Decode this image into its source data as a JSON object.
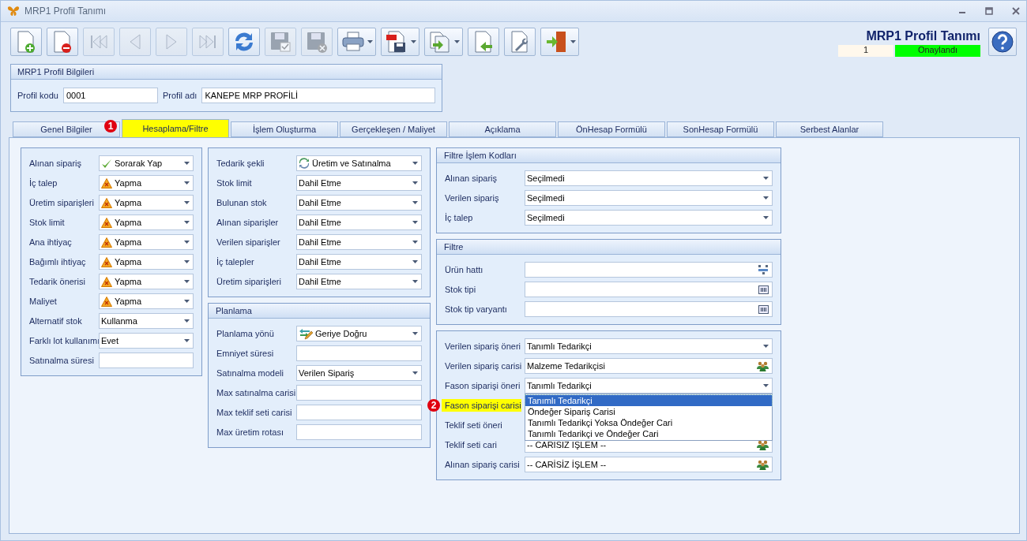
{
  "window": {
    "title": "MRP1 Profil Tanımı"
  },
  "toolbar": [
    {
      "kind": "new",
      "disabled": false,
      "menu": false
    },
    {
      "kind": "delete",
      "disabled": false,
      "menu": false
    },
    {
      "kind": "first",
      "disabled": true,
      "menu": false
    },
    {
      "kind": "prev",
      "disabled": true,
      "menu": false
    },
    {
      "kind": "next",
      "disabled": true,
      "menu": false
    },
    {
      "kind": "last",
      "disabled": true,
      "menu": false
    },
    {
      "kind": "refresh",
      "disabled": false,
      "menu": false
    },
    {
      "kind": "save",
      "disabled": true,
      "menu": false
    },
    {
      "kind": "discard",
      "disabled": true,
      "menu": false
    },
    {
      "kind": "print",
      "disabled": false,
      "menu": true
    },
    {
      "kind": "pdf",
      "disabled": false,
      "menu": true
    },
    {
      "kind": "export",
      "disabled": false,
      "menu": true
    },
    {
      "kind": "import",
      "disabled": false,
      "menu": false
    },
    {
      "kind": "settings",
      "disabled": false,
      "menu": false
    },
    {
      "kind": "exit",
      "disabled": false,
      "menu": true
    }
  ],
  "header": {
    "title": "MRP1 Profil Tanımı",
    "number": "1",
    "status": "Onaylandı"
  },
  "profile": {
    "title": "MRP1 Profil Bilgileri",
    "fields": [
      {
        "label": "Profil kodu",
        "value": "0001"
      },
      {
        "label": "Profil adı",
        "value": "KANEPE MRP PROFİLİ"
      }
    ]
  },
  "tabs": [
    {
      "label": "Genel Bilgiler",
      "selected": false,
      "highlighted": false
    },
    {
      "label": "Hesaplama/Filtre",
      "selected": true,
      "highlighted": true,
      "marker": "1"
    },
    {
      "label": "İşlem Oluşturma",
      "selected": false,
      "highlighted": false
    },
    {
      "label": "Gerçekleşen / Maliyet",
      "selected": false,
      "highlighted": false
    },
    {
      "label": "Açıklama",
      "selected": false,
      "highlighted": false
    },
    {
      "label": "ÖnHesap Formülü",
      "selected": false,
      "highlighted": false
    },
    {
      "label": "SonHesap Formülü",
      "selected": false,
      "highlighted": false
    },
    {
      "label": "Serbest Alanlar",
      "selected": false,
      "highlighted": false
    }
  ],
  "columns": [
    [
      {
        "rows": [
          {
            "label": "Alınan sipariş",
            "kind": "okcombo",
            "value": "Sorarak Yap"
          },
          {
            "label": "İç talep",
            "kind": "warncombo",
            "value": "Yapma"
          },
          {
            "label": "Üretim siparişleri",
            "kind": "warncombo",
            "value": "Yapma"
          },
          {
            "label": "Stok limit",
            "kind": "warncombo",
            "value": "Yapma"
          },
          {
            "label": "Ana ihtiyaç",
            "kind": "warncombo",
            "value": "Yapma"
          },
          {
            "label": "Bağımlı ihtiyaç",
            "kind": "warncombo",
            "value": "Yapma"
          },
          {
            "label": "Tedarik önerisi",
            "kind": "warncombo",
            "value": "Yapma"
          },
          {
            "label": "Maliyet",
            "kind": "warncombo",
            "value": "Yapma"
          },
          {
            "label": "Alternatif stok",
            "kind": "combo",
            "value": "Kullanma"
          },
          {
            "label": "Farklı lot kullanımı",
            "kind": "combo",
            "value": "Evet"
          },
          {
            "label": "Satınalma süresi",
            "kind": "text"
          }
        ]
      }
    ],
    [
      {
        "rows": [
          {
            "label": "Tedarik şekli",
            "kind": "cyclecombo",
            "value": "Üretim ve Satınalma"
          },
          {
            "label": "Stok limit",
            "kind": "combo",
            "value": "Dahil Etme"
          },
          {
            "label": "Bulunan stok",
            "kind": "combo",
            "value": "Dahil Etme"
          },
          {
            "label": "Alınan siparişler",
            "kind": "combo",
            "value": "Dahil Etme"
          },
          {
            "label": "Verilen siparişler",
            "kind": "combo",
            "value": "Dahil Etme"
          },
          {
            "label": "İç talepler",
            "kind": "combo",
            "value": "Dahil Etme"
          },
          {
            "label": "Üretim siparişleri",
            "kind": "combo",
            "value": "Dahil Etme"
          }
        ]
      },
      {
        "title": "Planlama",
        "rows": [
          {
            "label": "Planlama yönü",
            "kind": "swapcombo",
            "value": "Geriye Doğru"
          },
          {
            "label": "Emniyet süresi",
            "kind": "text"
          },
          {
            "label": "Satınalma modeli",
            "kind": "combo",
            "value": "Verilen Sipariş"
          },
          {
            "label": "Max satınalma carisi",
            "kind": "text"
          },
          {
            "label": "Max teklif seti carisi",
            "kind": "text"
          },
          {
            "label": "Max üretim rotası",
            "kind": "text"
          }
        ]
      }
    ],
    [
      {
        "title": "Filtre İşlem Kodları",
        "rows": [
          {
            "label": "Alınan sipariş",
            "kind": "combo",
            "value": "Seçilmedi"
          },
          {
            "label": "Verilen sipariş",
            "kind": "combo",
            "value": "Seçilmedi"
          },
          {
            "label": "İç talep",
            "kind": "combo",
            "value": "Seçilmedi"
          }
        ]
      },
      {
        "title": "Filtre",
        "rows": [
          {
            "label": "Ürün hattı",
            "kind": "treelookup"
          },
          {
            "label": "Stok tipi",
            "kind": "listlookup"
          },
          {
            "label": "Stok tip varyantı",
            "kind": "listlookup"
          }
        ]
      },
      {
        "rows": [
          {
            "label": "Verilen sipariş öneri",
            "kind": "combo",
            "value": "Tanımlı Tedarikçi"
          },
          {
            "label": "Verilen sipariş carisi",
            "kind": "contactlookup",
            "value": "Malzeme Tedarikçisi"
          },
          {
            "label": "Fason siparişi öneri",
            "kind": "combo",
            "value": "Tanımlı Tedarikçi",
            "options": [
              {
                "label": "Tanımlı Tedarikçi",
                "selected": true
              },
              {
                "label": "Öndeğer Sipariş Carisi",
                "selected": false
              },
              {
                "label": "Tanımlı Tedarikçi Yoksa Öndeğer Cari",
                "selected": false
              },
              {
                "label": "Tanımlı Tedarikçi ve Öndeğer Cari",
                "selected": false
              }
            ]
          },
          {
            "label": "Fason siparişi carisi",
            "kind": "covered",
            "highlighted": true,
            "marker": "2"
          },
          {
            "label": "Teklif seti öneri",
            "kind": "covered",
            "highlighted": false
          },
          {
            "label": "Teklif seti cari",
            "kind": "contactlookup",
            "value": "-- CARİSİZ İŞLEM --"
          },
          {
            "label": "Alınan sipariş carisi",
            "kind": "contactlookup",
            "value": "-- CARİSİZ İŞLEM --"
          }
        ]
      }
    ]
  ]
}
